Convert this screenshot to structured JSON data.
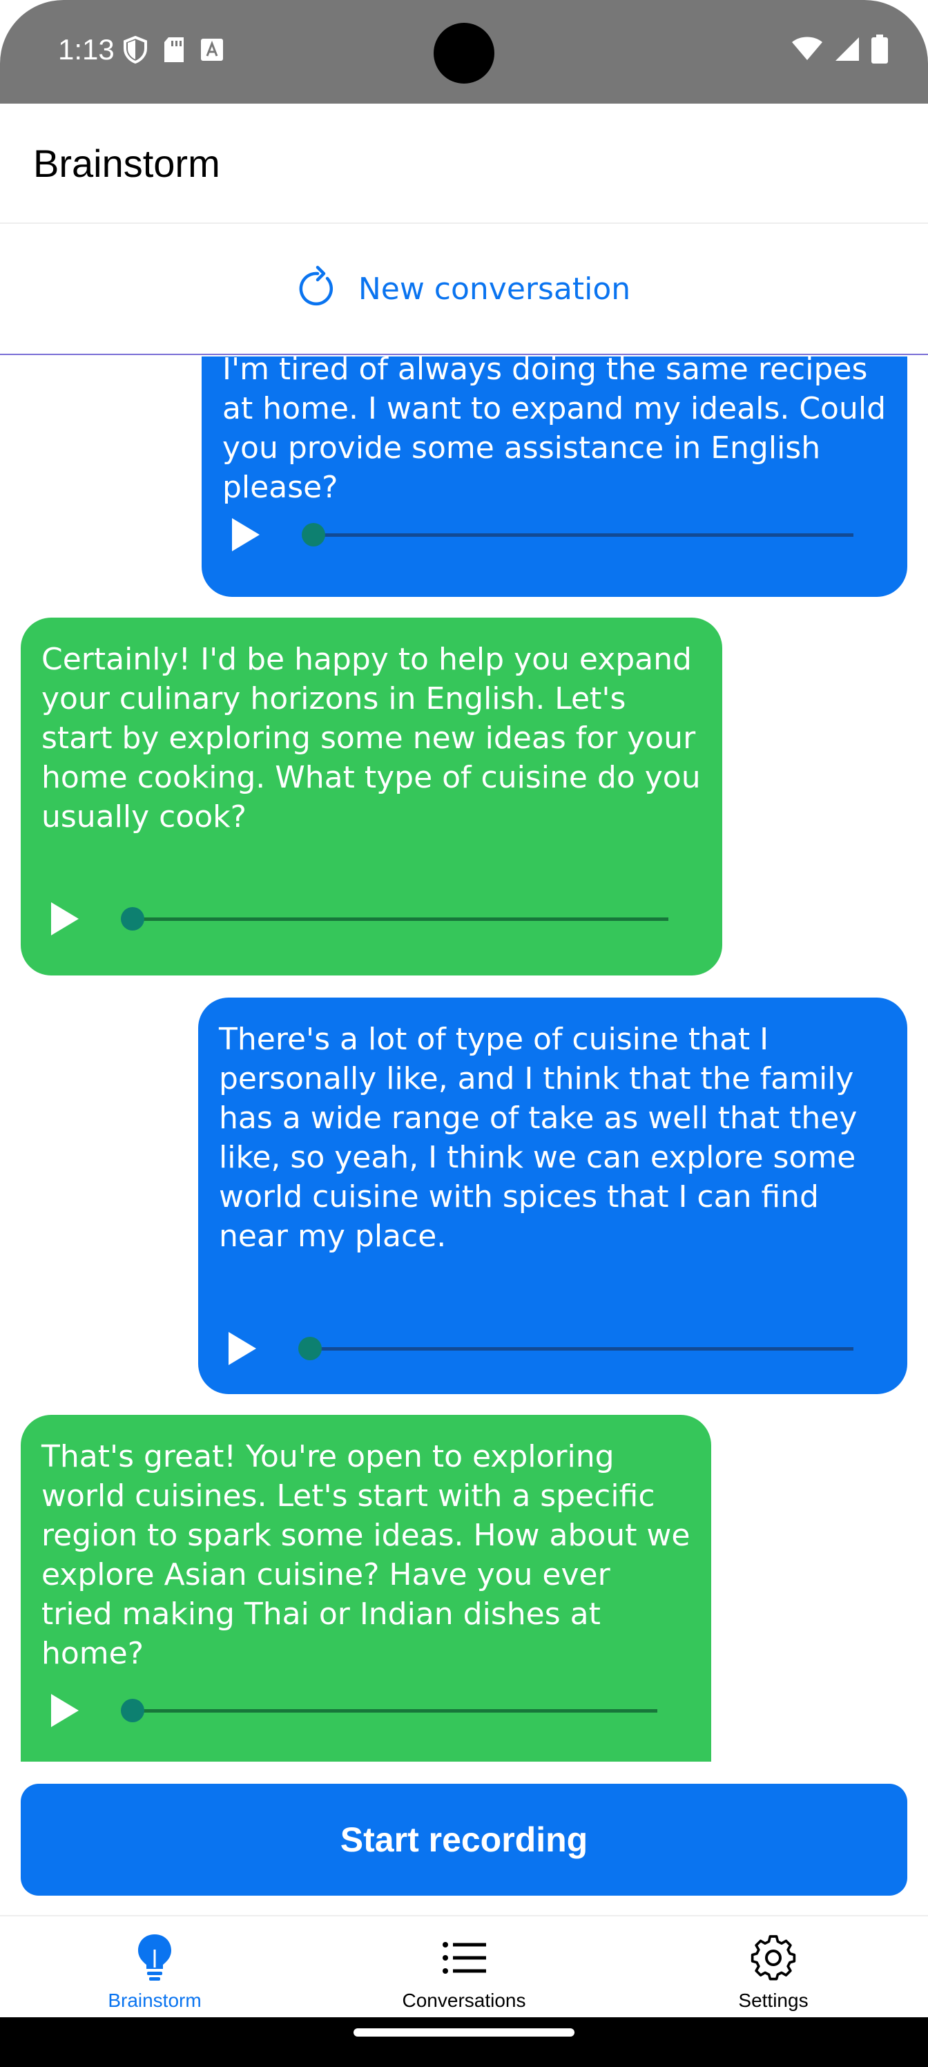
{
  "status_bar": {
    "time": "1:13"
  },
  "app_bar": {
    "title": "Brainstorm"
  },
  "new_conversation": {
    "label": "New conversation",
    "icon": "refresh-icon"
  },
  "messages": [
    {
      "role": "user",
      "text": "I'm tired of always doing the same recipes at home. I want to expand my ideals. Could you provide some assistance in English please?",
      "progress": 0
    },
    {
      "role": "assistant",
      "text": "Certainly! I'd be happy to help you expand your culinary horizons in English. Let's start by exploring some new ideas for your home cooking. What type of cuisine do you usually cook?",
      "progress": 0
    },
    {
      "role": "user",
      "text": "There's a lot of type of cuisine that I personally like, and I think that the family has a wide range of take as well that they like, so yeah, I think we can explore some world cuisine with spices that I can find near my place.",
      "progress": 0
    },
    {
      "role": "assistant",
      "text": "That's great! You're open to exploring world cuisines. Let's start with a specific region to spark some ideas. How about we explore Asian cuisine? Have you ever tried making Thai or Indian dishes at home?",
      "progress": 0
    }
  ],
  "record_button": {
    "label": "Start recording"
  },
  "bottom_nav": {
    "items": [
      {
        "label": "Brainstorm",
        "icon": "lightbulb-icon",
        "active": true
      },
      {
        "label": "Conversations",
        "icon": "list-icon",
        "active": false
      },
      {
        "label": "Settings",
        "icon": "gear-icon",
        "active": false
      }
    ]
  },
  "colors": {
    "accent": "#0a74f0",
    "user_bubble": "#0a74f0",
    "assistant_bubble": "#36c65a",
    "status_bar": "#777777"
  }
}
